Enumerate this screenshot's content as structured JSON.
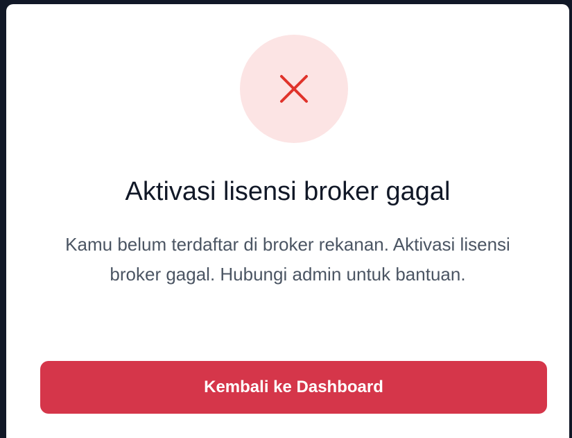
{
  "dialog": {
    "status_icon": "close-x-icon",
    "title": "Aktivasi lisensi broker gagal",
    "message": "Kamu belum terdaftar di broker rekanan. Aktivasi lisensi broker gagal. Hubungi admin untuk bantuan.",
    "primary_button_label": "Kembali ke Dashboard"
  },
  "colors": {
    "backdrop": "#111827",
    "dialog_background": "#ffffff",
    "icon_circle": "#fce4e4",
    "icon_stroke": "#e0332b",
    "title_text": "#111827",
    "message_text": "#4b5563",
    "button_background": "#d5364a",
    "button_text": "#ffffff"
  }
}
